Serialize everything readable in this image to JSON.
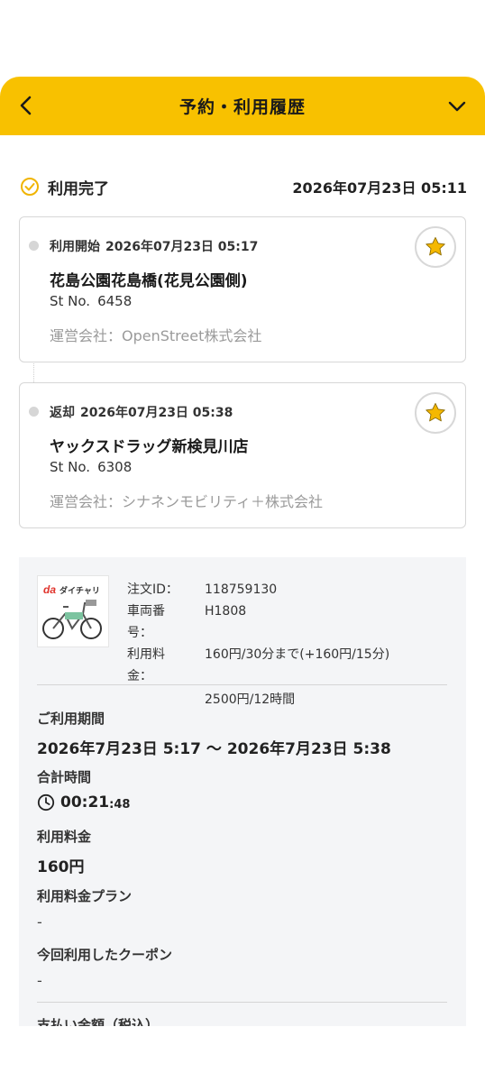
{
  "header": {
    "title": "予約・利用履歴"
  },
  "status": {
    "label": "利用完了",
    "datetime": "2026年07月23日 05:11"
  },
  "start": {
    "label": "利用開始",
    "datetime": "2026年07月23日 05:17",
    "station_name": "花島公園花島橋(花見公園側)",
    "st_no_label": "St No.",
    "st_no": "6458",
    "operator": "運営会社：OpenStreet株式会社"
  },
  "end": {
    "label": "返却",
    "datetime": "2026年07月23日 05:38",
    "station_name": "ヤックスドラッグ新検見川店",
    "st_no_label": "St No.",
    "st_no": "6308",
    "operator": "運営会社：シナネンモビリティ＋株式会社"
  },
  "detail": {
    "brand_logo_text": "ダイチャリ",
    "order_id_label": "注文ID：",
    "order_id": "118759130",
    "vehicle_label": "車両番号：",
    "vehicle": "H1808",
    "fee_label": "利用料金：",
    "fee_line1": "160円/30分まで(+160円/15分)",
    "fee_line2": "2500円/12時間",
    "period_label": "ご利用期間",
    "period_value": "2026年7月23日 5:17 〜 2026年7月23日 5:38",
    "total_time_label": "合計時間",
    "total_time_hm": "00:21",
    "total_time_s": ":48",
    "usage_fee_label": "利用料金",
    "usage_fee_value": "160円",
    "plan_label": "利用料金プラン",
    "plan_value": "-",
    "coupon_label": "今回利用したクーポン",
    "coupon_value": "-",
    "payment_label": "支払い金額（税込）"
  },
  "colors": {
    "accent": "#f8c100",
    "star": "#f5b800",
    "check": "#f0b400"
  }
}
